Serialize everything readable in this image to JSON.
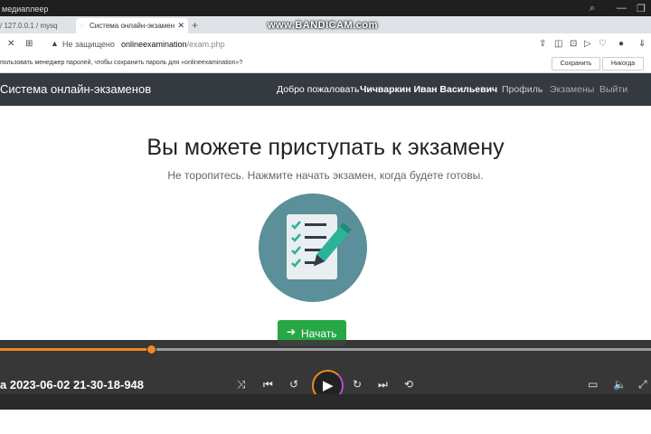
{
  "window": {
    "title": "медиаплеер",
    "watermark": "www.BANDICAM.com"
  },
  "tabs": [
    {
      "label": "/ 127.0.0.1 / mysq"
    },
    {
      "label": "Система онлайн-экзамен"
    },
    {
      "new_tab": "+"
    }
  ],
  "address": {
    "security_label": "Не защищено",
    "url_host": "onlineexamination",
    "url_path": "/exam.php"
  },
  "password_bar": {
    "message": "пользовать менеджер паролей, чтобы сохранить пароль для «onlineexamination»?",
    "save_label": "Сохранить",
    "never_label": "Никогда"
  },
  "site": {
    "brand": "Система онлайн-экзаменов",
    "welcome": "Добро пожаловать",
    "username": "Чичваркин Иван Васильевич",
    "nav": [
      "Профиль",
      "Экзамены",
      "Выйти"
    ]
  },
  "main": {
    "title": "Вы можете приступать к экзамену",
    "subtitle": "Не торопитесь. Нажмите начать экзамен, когда будете готовы.",
    "start_label": "Начать"
  },
  "player": {
    "file_title": "а 2023-06-02 21-30-18-948",
    "progress": 0.232
  },
  "colors": {
    "navbar": "#343a40",
    "start_button": "#28a745",
    "seek_accent": "#f08a24",
    "illustration_circle": "#5b8f99"
  }
}
